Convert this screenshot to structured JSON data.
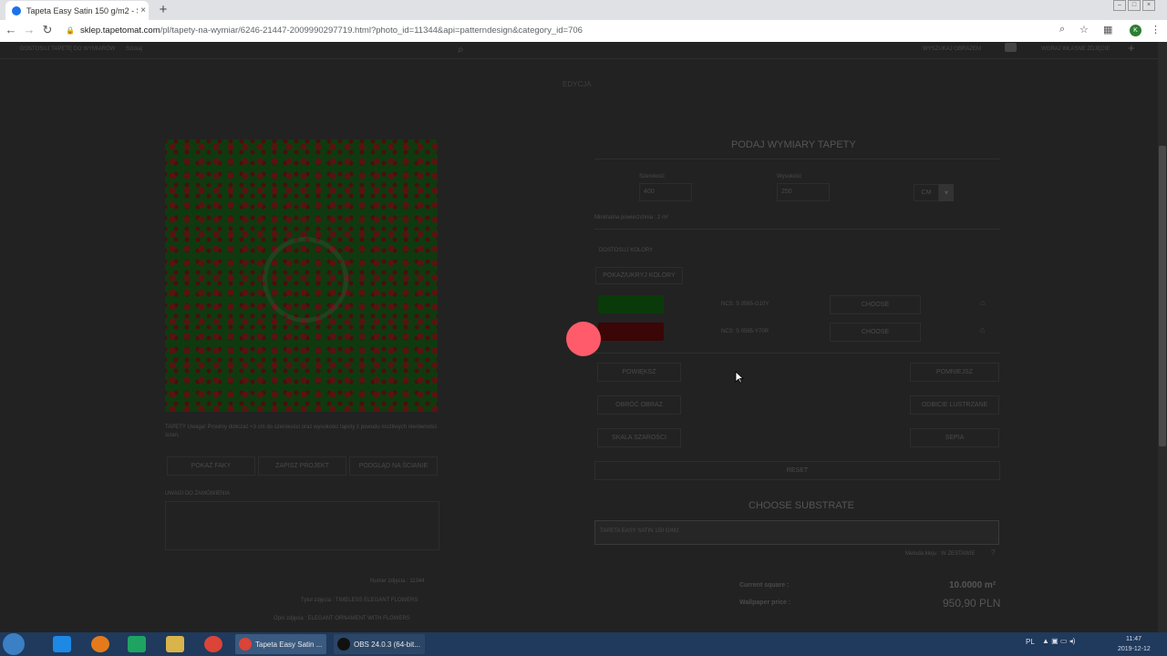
{
  "browser": {
    "tab_title": "Tapeta Easy Satin 150 g/m2 - Sa",
    "tab_close": "×",
    "new_tab": "+",
    "url_domain": "sklep.tapetomat.com",
    "url_path": "/pl/tapety-na-wymiar/6246-21447-2009990297719.html?photo_id=11344&api=patterndesign&category_id=706",
    "profile_initial": "K"
  },
  "page": {
    "top_nav_left": "DOSTOSUJ TAPETĘ DO WYMIARÓW",
    "top_nav_search_placeholder": "Szukaj",
    "top_nav_right1": "WYSZUKAJ OBRAZEM",
    "top_nav_right2": "WGRAJ WŁASNE ZDJĘCIE",
    "edition": "EDYCJA",
    "heading": "PODAJ WYMIARY TAPETY",
    "width_label": "Szerokość",
    "width_value": "400",
    "height_label": "Wysokość",
    "height_value": "250",
    "unit": "CM",
    "min_area": "Minimalna powierzchnia : 2 m²",
    "adjust_colors": "DOSTOSUJ KOLORY",
    "show_colors": "POKAŻ/UKRYJ KOLORY",
    "color1_code": "NCS: S 0565-G10Y",
    "color2_code": "NCS: S 0585-Y70R",
    "choose": "CHOOSE",
    "enlarge": "POWIĘKSZ",
    "shrink": "POMNIEJSZ",
    "rotate": "OBRÓĆ OBRAZ",
    "mirror": "ODBICIE LUSTRZANE",
    "grayscale": "SKALA SZAROŚCI",
    "sepia": "SEPIA",
    "reset": "RESET",
    "substrate_heading": "CHOOSE SUBSTRATE",
    "substrate_value": "TAPETA EASY SATIN 150 G/M2",
    "glue_note": "Metoda kleju : W ZESTAWIE",
    "current_square_label": "Current square :",
    "current_square_value": "10.0000 m²",
    "price_label": "Wallpaper price :",
    "price_value": "950,90 PLN",
    "notice": "TAPETY Uwaga! Prosimy doliczać +3 cm do szerokości oraz wysokości tapety z powodu możliwych nierówności ścian.",
    "btn_show": "POKAŻ FAKY",
    "btn_save": "ZAPISZ PROJEKT",
    "btn_wall": "PODGLĄD NA ŚCIANIE",
    "remarks_label": "UWAGI DO ZAMÓWIENIA",
    "photo_no": "Numer zdjęcia : 11344",
    "photo_title": "Tytuł zdjęcia : TIMELESS ELEGANT FLOWERS",
    "photo_desc": "Opis zdjęcia : ELEGANT ORNAMENT WITH FLOWERS"
  },
  "colors": {
    "swatch1": "#0a5a0a",
    "swatch2": "#6a0d0d",
    "cursor_marker": "#ff5b6b"
  },
  "taskbar": {
    "task1": "Tapeta Easy Satin ...",
    "task2": "OBS 24.0.3 (64-bit...",
    "lang": "PL",
    "time": "11:47",
    "date": "2019-12-12"
  }
}
